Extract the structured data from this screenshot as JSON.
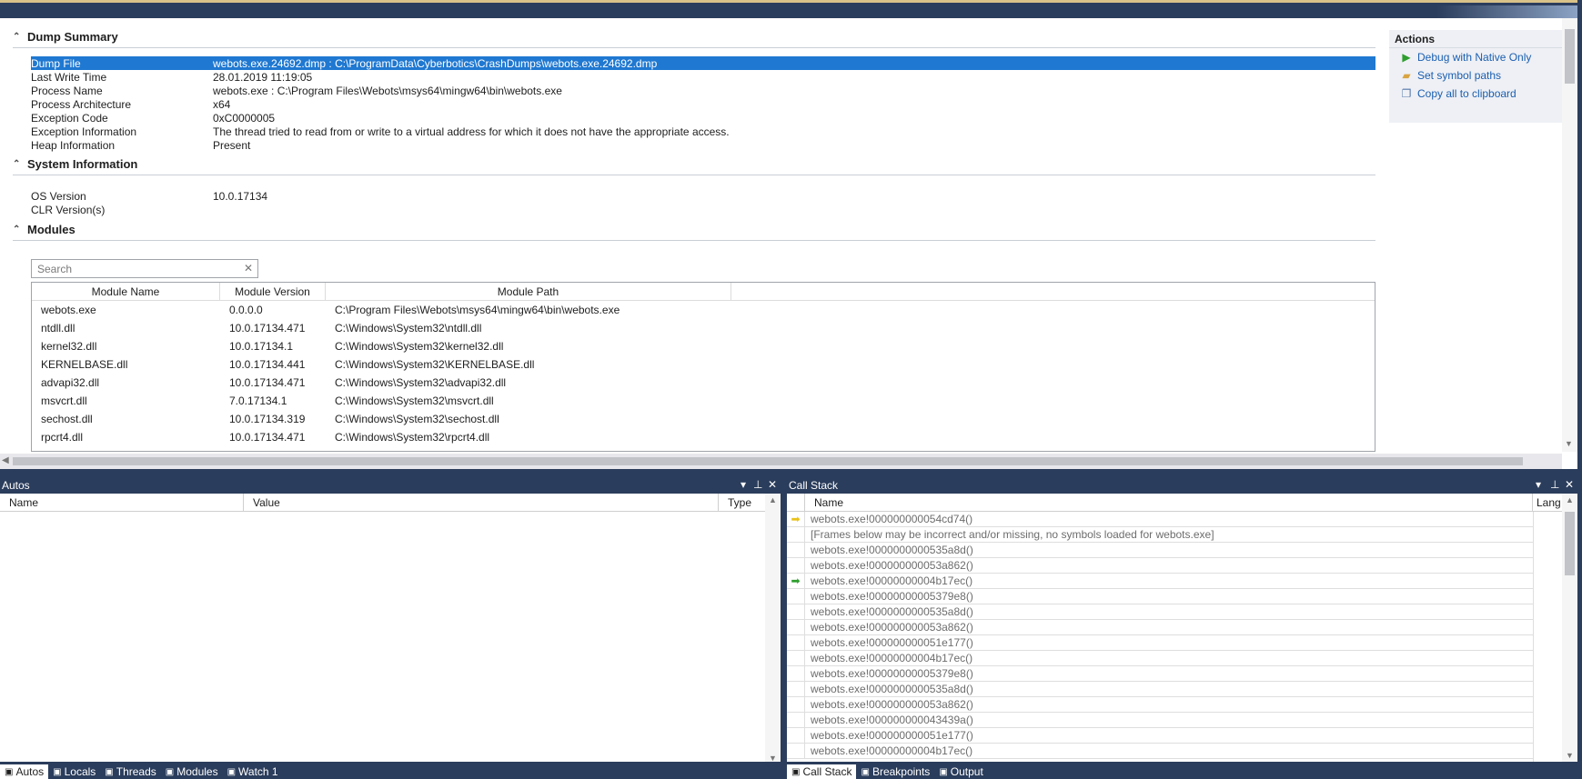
{
  "dump_summary": {
    "title": "Dump Summary",
    "rows": [
      {
        "key": "Dump File",
        "value": "webots.exe.24692.dmp : C:\\ProgramData\\Cyberbotics\\CrashDumps\\webots.exe.24692.dmp"
      },
      {
        "key": "Last Write Time",
        "value": "28.01.2019 11:19:05"
      },
      {
        "key": "Process Name",
        "value": "webots.exe : C:\\Program Files\\Webots\\msys64\\mingw64\\bin\\webots.exe"
      },
      {
        "key": "Process Architecture",
        "value": "x64"
      },
      {
        "key": "Exception Code",
        "value": "0xC0000005"
      },
      {
        "key": "Exception Information",
        "value": "The thread tried to read from or write to a virtual address for which it does not have the appropriate access."
      },
      {
        "key": "Heap Information",
        "value": "Present"
      }
    ]
  },
  "system_info": {
    "title": "System Information",
    "rows": [
      {
        "key": "OS Version",
        "value": "10.0.17134"
      },
      {
        "key": "CLR Version(s)",
        "value": ""
      }
    ]
  },
  "modules": {
    "title": "Modules",
    "search_placeholder": "Search",
    "columns": [
      "Module Name",
      "Module Version",
      "Module Path"
    ],
    "rows": [
      [
        "webots.exe",
        "0.0.0.0",
        "C:\\Program Files\\Webots\\msys64\\mingw64\\bin\\webots.exe"
      ],
      [
        "ntdll.dll",
        "10.0.17134.471",
        "C:\\Windows\\System32\\ntdll.dll"
      ],
      [
        "kernel32.dll",
        "10.0.17134.1",
        "C:\\Windows\\System32\\kernel32.dll"
      ],
      [
        "KERNELBASE.dll",
        "10.0.17134.441",
        "C:\\Windows\\System32\\KERNELBASE.dll"
      ],
      [
        "advapi32.dll",
        "10.0.17134.471",
        "C:\\Windows\\System32\\advapi32.dll"
      ],
      [
        "msvcrt.dll",
        "7.0.17134.1",
        "C:\\Windows\\System32\\msvcrt.dll"
      ],
      [
        "sechost.dll",
        "10.0.17134.319",
        "C:\\Windows\\System32\\sechost.dll"
      ],
      [
        "rpcrt4.dll",
        "10.0.17134.471",
        "C:\\Windows\\System32\\rpcrt4.dll"
      ]
    ]
  },
  "actions": {
    "title": "Actions",
    "items": [
      {
        "label": "Debug with Native Only",
        "icon": "play-icon",
        "color": "#2e9e2e"
      },
      {
        "label": "Set symbol paths",
        "icon": "folder-icon",
        "color": "#d9a441"
      },
      {
        "label": "Copy all to clipboard",
        "icon": "copy-icon",
        "color": "#5577aa"
      }
    ]
  },
  "autos": {
    "title": "Autos",
    "columns": [
      "Name",
      "Value",
      "Type"
    ]
  },
  "callstack": {
    "title": "Call Stack",
    "columns": [
      "Name",
      "Lang"
    ],
    "frames": [
      {
        "name": "webots.exe!000000000054cd74()",
        "marker": "current"
      },
      {
        "name": "[Frames below may be incorrect and/or missing, no symbols loaded for webots.exe]",
        "marker": ""
      },
      {
        "name": "webots.exe!0000000000535a8d()",
        "marker": ""
      },
      {
        "name": "webots.exe!000000000053a862()",
        "marker": ""
      },
      {
        "name": "webots.exe!00000000004b17ec()",
        "marker": "caller"
      },
      {
        "name": "webots.exe!00000000005379e8()",
        "marker": ""
      },
      {
        "name": "webots.exe!0000000000535a8d()",
        "marker": ""
      },
      {
        "name": "webots.exe!000000000053a862()",
        "marker": ""
      },
      {
        "name": "webots.exe!000000000051e177()",
        "marker": ""
      },
      {
        "name": "webots.exe!00000000004b17ec()",
        "marker": ""
      },
      {
        "name": "webots.exe!00000000005379e8()",
        "marker": ""
      },
      {
        "name": "webots.exe!0000000000535a8d()",
        "marker": ""
      },
      {
        "name": "webots.exe!000000000053a862()",
        "marker": ""
      },
      {
        "name": "webots.exe!000000000043439a()",
        "marker": ""
      },
      {
        "name": "webots.exe!000000000051e177()",
        "marker": ""
      },
      {
        "name": "webots.exe!00000000004b17ec()",
        "marker": ""
      }
    ]
  },
  "bottom_tabs_left": [
    {
      "label": "Autos",
      "active": true
    },
    {
      "label": "Locals",
      "active": false
    },
    {
      "label": "Threads",
      "active": false
    },
    {
      "label": "Modules",
      "active": false
    },
    {
      "label": "Watch 1",
      "active": false
    }
  ],
  "bottom_tabs_right": [
    {
      "label": "Call Stack",
      "active": true
    },
    {
      "label": "Breakpoints",
      "active": false
    },
    {
      "label": "Output",
      "active": false
    }
  ],
  "colors": {
    "accent_selected": "#1f78d1",
    "panel_title": "#2b3d5c",
    "link": "#1b5fb0"
  }
}
